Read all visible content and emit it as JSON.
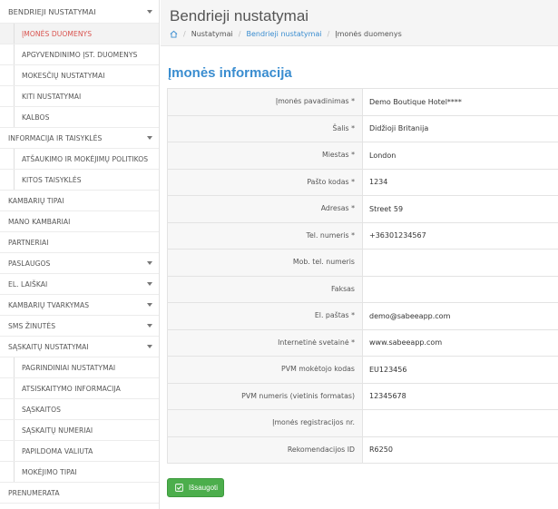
{
  "sidebar": {
    "items": [
      {
        "label": "BENDRIEJI NUSTATYMAI",
        "level": "top",
        "caret": true,
        "active": false
      },
      {
        "label": "ĮMONĖS DUOMENYS",
        "level": "sub",
        "caret": false,
        "active": true
      },
      {
        "label": "APGYVENDINIMO ĮST. DUOMENYS",
        "level": "sub",
        "caret": false,
        "active": false
      },
      {
        "label": "MOKESČIŲ NUSTATYMAI",
        "level": "sub",
        "caret": false,
        "active": false
      },
      {
        "label": "KITI NUSTATYMAI",
        "level": "sub",
        "caret": false,
        "active": false
      },
      {
        "label": "KALBOS",
        "level": "sub",
        "caret": false,
        "active": false
      },
      {
        "label": "INFORMACIJA IR TAISYKLĖS",
        "level": "top",
        "caret": true,
        "active": false
      },
      {
        "label": "ATŠAUKIMO IR MOKĖJIMŲ POLITIKOS",
        "level": "sub",
        "caret": false,
        "active": false
      },
      {
        "label": "KITOS TAISYKLĖS",
        "level": "sub",
        "caret": false,
        "active": false
      },
      {
        "label": "KAMBARIŲ TIPAI",
        "level": "top",
        "caret": false,
        "active": false
      },
      {
        "label": "MANO KAMBARIAI",
        "level": "top",
        "caret": false,
        "active": false
      },
      {
        "label": "PARTNERIAI",
        "level": "top",
        "caret": false,
        "active": false
      },
      {
        "label": "PASLAUGOS",
        "level": "top",
        "caret": true,
        "active": false
      },
      {
        "label": "EL. LAIŠKAI",
        "level": "top",
        "caret": true,
        "active": false
      },
      {
        "label": "KAMBARIŲ TVARKYMAS",
        "level": "top",
        "caret": true,
        "active": false
      },
      {
        "label": "SMS ŽINUTĖS",
        "level": "top",
        "caret": true,
        "active": false
      },
      {
        "label": "SĄSKAITŲ NUSTATYMAI",
        "level": "top",
        "caret": true,
        "active": false
      },
      {
        "label": "PAGRINDINIAI NUSTATYMAI",
        "level": "sub",
        "caret": false,
        "active": false
      },
      {
        "label": "ATSISKAITYMO INFORMACIJA",
        "level": "sub",
        "caret": false,
        "active": false
      },
      {
        "label": "SĄSKAITOS",
        "level": "sub",
        "caret": false,
        "active": false
      },
      {
        "label": "SĄSKAITŲ NUMERIAI",
        "level": "sub",
        "caret": false,
        "active": false
      },
      {
        "label": "PAPILDOMA VALIUTA",
        "level": "sub",
        "caret": false,
        "active": false
      },
      {
        "label": "MOKĖJIMO TIPAI",
        "level": "sub",
        "caret": false,
        "active": false
      },
      {
        "label": "PRENUMERATA",
        "level": "top",
        "caret": false,
        "active": false
      }
    ]
  },
  "header": {
    "title": "Bendrieji nustatymai",
    "breadcrumb": [
      "Nustatymai",
      "Bendrieji nustatymai",
      "Įmonės duomenys"
    ]
  },
  "section": {
    "title": "Įmonės informacija"
  },
  "form": {
    "rows": [
      {
        "label": "Įmonės pavadinimas *",
        "value": "Demo Boutique Hotel****"
      },
      {
        "label": "Šalis *",
        "value": " Didžioji Britanija"
      },
      {
        "label": "Miestas *",
        "value": "London"
      },
      {
        "label": "Pašto kodas *",
        "value": "1234"
      },
      {
        "label": "Adresas *",
        "value": "Street 59"
      },
      {
        "label": "Tel. numeris *",
        "value": "+36301234567"
      },
      {
        "label": "Mob. tel. numeris",
        "value": ""
      },
      {
        "label": "Faksas",
        "value": ""
      },
      {
        "label": "El. paštas *",
        "value": "demo@sabeeapp.com"
      },
      {
        "label": "Internetinė svetainė *",
        "value": "www.sabeeapp.com"
      },
      {
        "label": "PVM mokėtojo kodas",
        "value": "EU123456"
      },
      {
        "label": "PVM numeris (vietinis formatas)",
        "value": "12345678"
      },
      {
        "label": "Įmonės registracijos nr.",
        "value": ""
      },
      {
        "label": "Rekomendacijos ID",
        "value": "R6250"
      }
    ]
  },
  "actions": {
    "save_label": "Išsaugoti"
  },
  "colors": {
    "accent": "#3a8dd0",
    "active_nav": "#d9534f",
    "save": "#4cae4c"
  },
  "icons": {
    "home": "home-icon",
    "save": "check-square-icon",
    "caret": "caret-down-icon"
  }
}
